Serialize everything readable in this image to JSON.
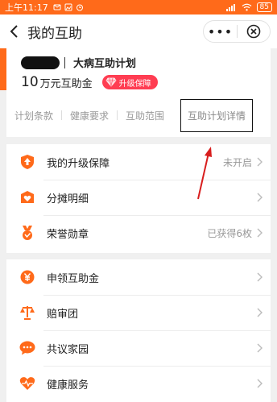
{
  "status_bar": {
    "time": "上午11:17",
    "battery": "85"
  },
  "header": {
    "title": "我的互助",
    "more_label": "•••"
  },
  "plan": {
    "name": "大病互助计划",
    "amount_number": "10",
    "amount_unit": "万元互助金",
    "badge": "升级保障"
  },
  "links": [
    "计划条款",
    "健康要求",
    "互助范围",
    "互助计划详情"
  ],
  "list1": [
    {
      "label": "我的升级保障",
      "status": "未开启",
      "icon": "shield-up-icon"
    },
    {
      "label": "分摊明细",
      "status": "",
      "icon": "heart-doc-icon"
    },
    {
      "label": "荣誉勋章",
      "status": "已获得6枚",
      "icon": "medal-icon"
    }
  ],
  "list2": [
    {
      "label": "申领互助金",
      "icon": "yuan-icon"
    },
    {
      "label": "赔审团",
      "icon": "scale-icon"
    },
    {
      "label": "共议家园",
      "icon": "chat-icon"
    },
    {
      "label": "健康服务",
      "icon": "health-icon"
    }
  ],
  "colors": {
    "accent": "#ff6a1a",
    "badge": "#ff3d52",
    "annotation": "#d81e1e"
  }
}
